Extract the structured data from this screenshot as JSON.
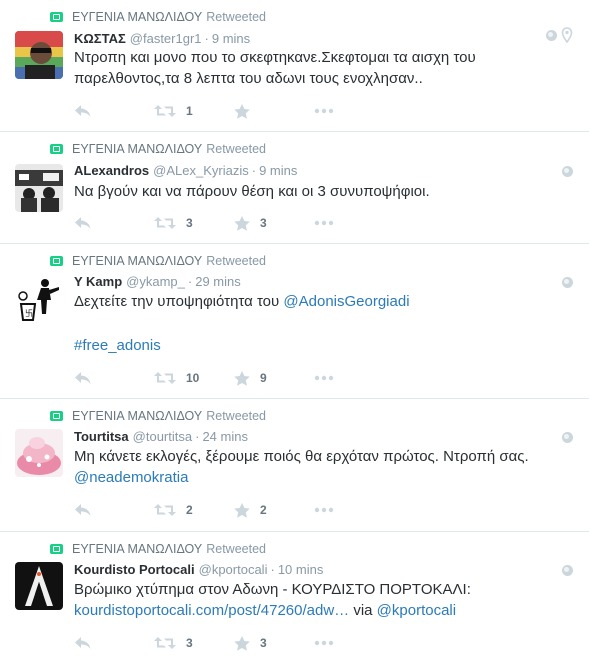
{
  "retweeter": "ΕΥΓΕΝΙΑ ΜΑΝΩΛΙΔΟΥ",
  "retweet_suffix": "Retweeted",
  "colors": {
    "link": "#2b7bb9",
    "retweet_green": "#19cf86",
    "muted": "#8899a6"
  },
  "tweets": [
    {
      "name": "ΚΩΣΤΑΣ",
      "handle": "@faster1gr1",
      "time": "9 mins",
      "line1": "Ντροπη και μονο που το σκεφτηκανε.Σκεφτομαι τα αισχη του",
      "line2": "παρελθοντος,τα 8 λεπτα του αδωνι τους ενοχλησαν..",
      "retweets": "1",
      "favorites": "",
      "geo": "location-pin-icon"
    },
    {
      "name": "ALexandros",
      "handle": "@ALex_Kyriazis",
      "time": "9 mins",
      "line1": "Να βγούν και να πάρουν θέση και οι 3 συνυποψήφιοι.",
      "retweets": "3",
      "favorites": "3"
    },
    {
      "name": "Y Kamp",
      "handle": "@ykamp_",
      "time": "29 mins",
      "line1_prefix": "Δεχτείτε την υποψηφιότητα του ",
      "line1_link": "@AdonisGeorgiadi",
      "hashtag": "#free_adonis",
      "retweets": "10",
      "favorites": "9"
    },
    {
      "name": "Tourtitsa",
      "handle": "@tourtitsa",
      "time": "24 mins",
      "line1": "Μη κάνετε εκλογές, ξέρουμε ποιός θα ερχόταν πρώτος. Ντροπή σας.",
      "mention": "@neademokratia",
      "retweets": "2",
      "favorites": "2"
    },
    {
      "name": "Kourdisto Portocali",
      "handle": "@kportocali",
      "time": "10 mins",
      "line1": "Βρώμικο χτύπημα στον Αδωνη - ΚΟΥΡΔΙΣΤΟ ΠΟΡΤΟΚΑΛΙ:",
      "url": "kourdistoportocali.com/post/47260/adw…",
      "via": " via ",
      "via_mention": "@kportocali",
      "retweets": "3",
      "favorites": "3"
    }
  ]
}
